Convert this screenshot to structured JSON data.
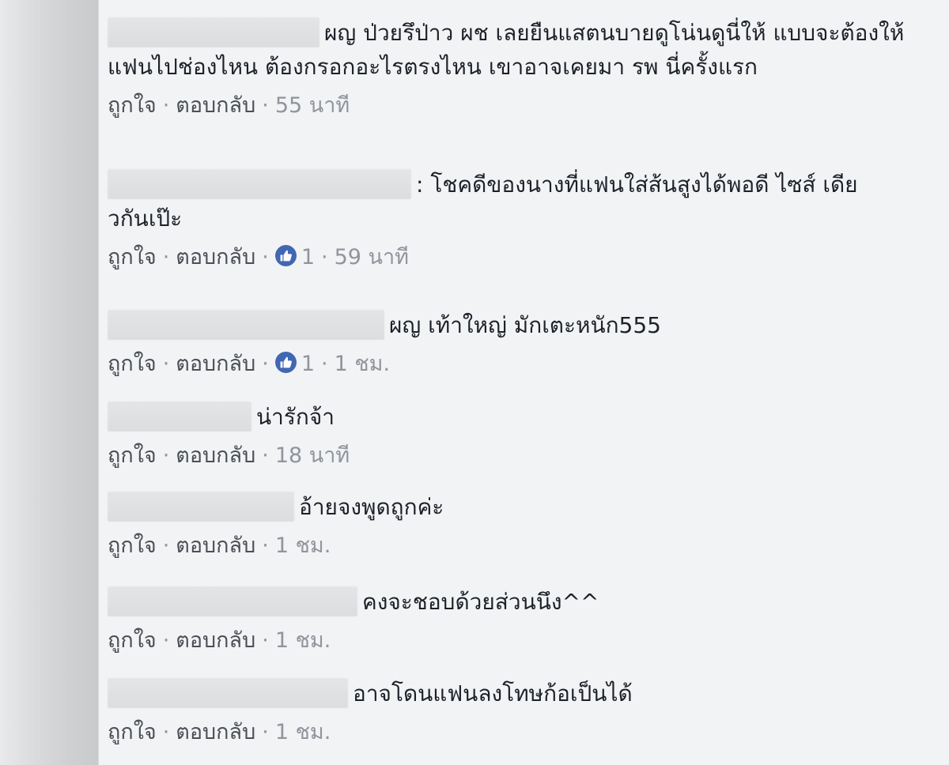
{
  "comments": [
    {
      "text": "ผญ ป่วยรึป่าว ผช เลยยืนแสตนบายดูโน่นดูนี่ให้ แบบจะต้องให้แฟนไปช่องไหน ต้องกรอกอะไรตรงไหน เขาอาจเคยมา รพ นี่ครั้งแรก",
      "like_label": "ถูกใจ",
      "reply_label": "ตอบกลับ",
      "reaction_count": "",
      "time": "55 นาที"
    },
    {
      "text": ": โชคดีของนางที่แฟนใส่ส้นสูงได้พอดี ไซส์ เดียวกันเป๊ะ",
      "like_label": "ถูกใจ",
      "reply_label": "ตอบกลับ",
      "reaction_count": "1",
      "time": "59 นาที"
    },
    {
      "text": "ผญ เท้าใหญ่ มักเตะหนัก555",
      "like_label": "ถูกใจ",
      "reply_label": "ตอบกลับ",
      "reaction_count": "1",
      "time": "1 ชม."
    },
    {
      "text": "น่ารักจ้า",
      "like_label": "ถูกใจ",
      "reply_label": "ตอบกลับ",
      "reaction_count": "",
      "time": "18 นาที"
    },
    {
      "text": "อ้ายจงพูดถูกค่ะ",
      "like_label": "ถูกใจ",
      "reply_label": "ตอบกลับ",
      "reaction_count": "",
      "time": "1 ชม."
    },
    {
      "text": "คงจะชอบด้วยส่วนนึง^^",
      "like_label": "ถูกใจ",
      "reply_label": "ตอบกลับ",
      "reaction_count": "",
      "time": "1 ชม."
    },
    {
      "text": "อาจโดนแฟนลงโทษก้อเป็นได้",
      "like_label": "ถูกใจ",
      "reply_label": "ตอบกลับ",
      "reaction_count": "",
      "time": "1 ชม."
    }
  ],
  "separator": "·",
  "icons": {
    "reaction": "thumbs-up-icon"
  },
  "colors": {
    "background": "#f2f3f5",
    "text": "#1d2129",
    "meta": "#90949c",
    "like_badge": "#4267b2"
  }
}
